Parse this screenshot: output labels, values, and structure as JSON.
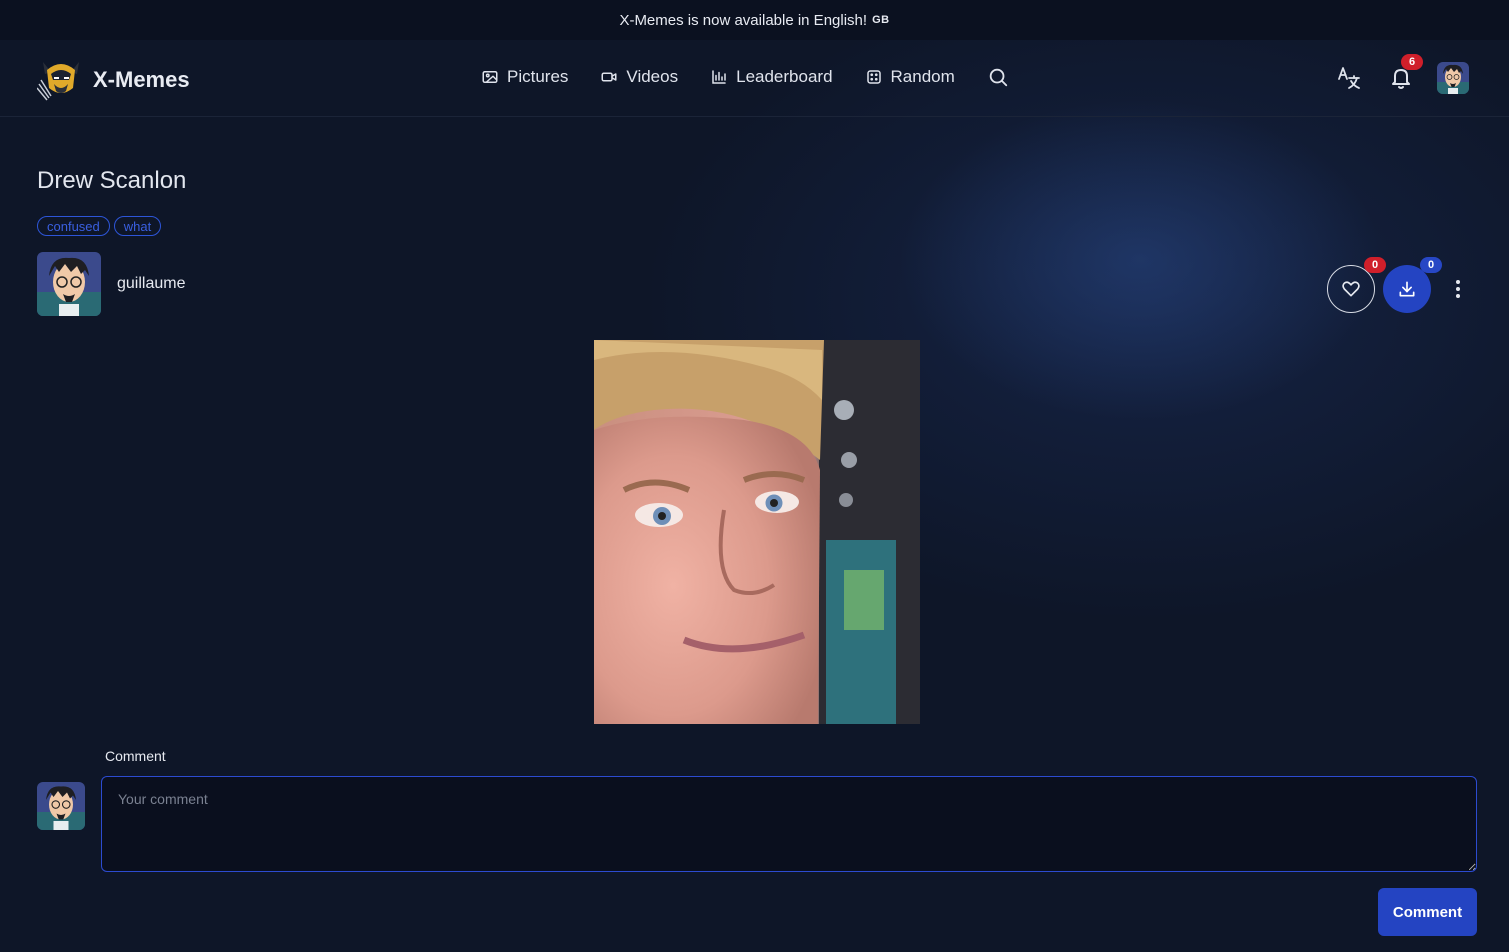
{
  "banner": {
    "text": "X-Memes is now available in English!",
    "flag": "GB"
  },
  "brand": {
    "name": "X-Memes",
    "logo_icon": "wolverine-logo-icon"
  },
  "nav": {
    "items": [
      {
        "label": "Pictures",
        "icon": "image-icon"
      },
      {
        "label": "Videos",
        "icon": "video-icon"
      },
      {
        "label": "Leaderboard",
        "icon": "bar-chart-icon"
      },
      {
        "label": "Random",
        "icon": "dice-icon"
      }
    ],
    "search_icon": "search-icon",
    "translate_icon": "translate-icon",
    "notifications": {
      "icon": "bell-icon",
      "count": "6"
    }
  },
  "post": {
    "title": "Drew Scanlon",
    "tags": [
      "confused",
      "what"
    ],
    "author": {
      "name": "guillaume"
    },
    "likes": "0",
    "downloads": "0",
    "media_alt": "Blinking white guy meme"
  },
  "comment": {
    "label": "Comment",
    "placeholder": "Your comment",
    "submit_label": "Comment"
  },
  "colors": {
    "accent": "#2444c2",
    "badge_red": "#d01f2a",
    "background": "#0e1628"
  }
}
